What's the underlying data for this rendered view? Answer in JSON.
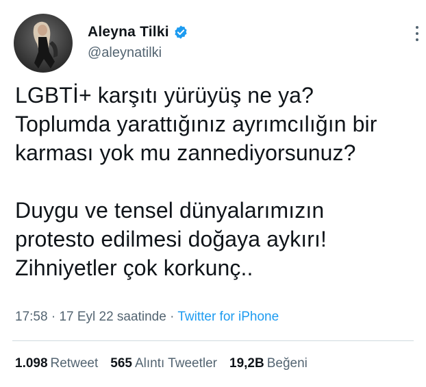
{
  "author": {
    "display_name": "Aleyna Tilki",
    "handle": "@aleynatilki",
    "verified": true,
    "avatar_icon": "user-avatar-photo"
  },
  "tweet": {
    "paragraphs": [
      [
        "LGBTİ+ karşıtı yürüyüş ne ya?",
        "Toplumda yarattığınız ayrımcılığın bir",
        "karması yok mu zannediyorsunuz?"
      ],
      [
        "Duygu ve tensel dünyalarımızın",
        "protesto edilmesi doğaya aykırı!",
        "Zihniyetler çok korkunç.."
      ]
    ],
    "time": "17:58",
    "separator": "·",
    "date": "17 Eyl 22 saatinde",
    "source": "Twitter for iPhone"
  },
  "stats": {
    "retweets": {
      "count": "1.098",
      "label": "Retweet"
    },
    "quotes": {
      "count": "565",
      "label": "Alıntı Tweetler"
    },
    "likes": {
      "count": "19,2B",
      "label": "Beğeni"
    }
  },
  "colors": {
    "verified": "#1d9bf0",
    "link": "#1d9bf0",
    "secondary_text": "#536471",
    "primary_text": "#0f1419"
  }
}
